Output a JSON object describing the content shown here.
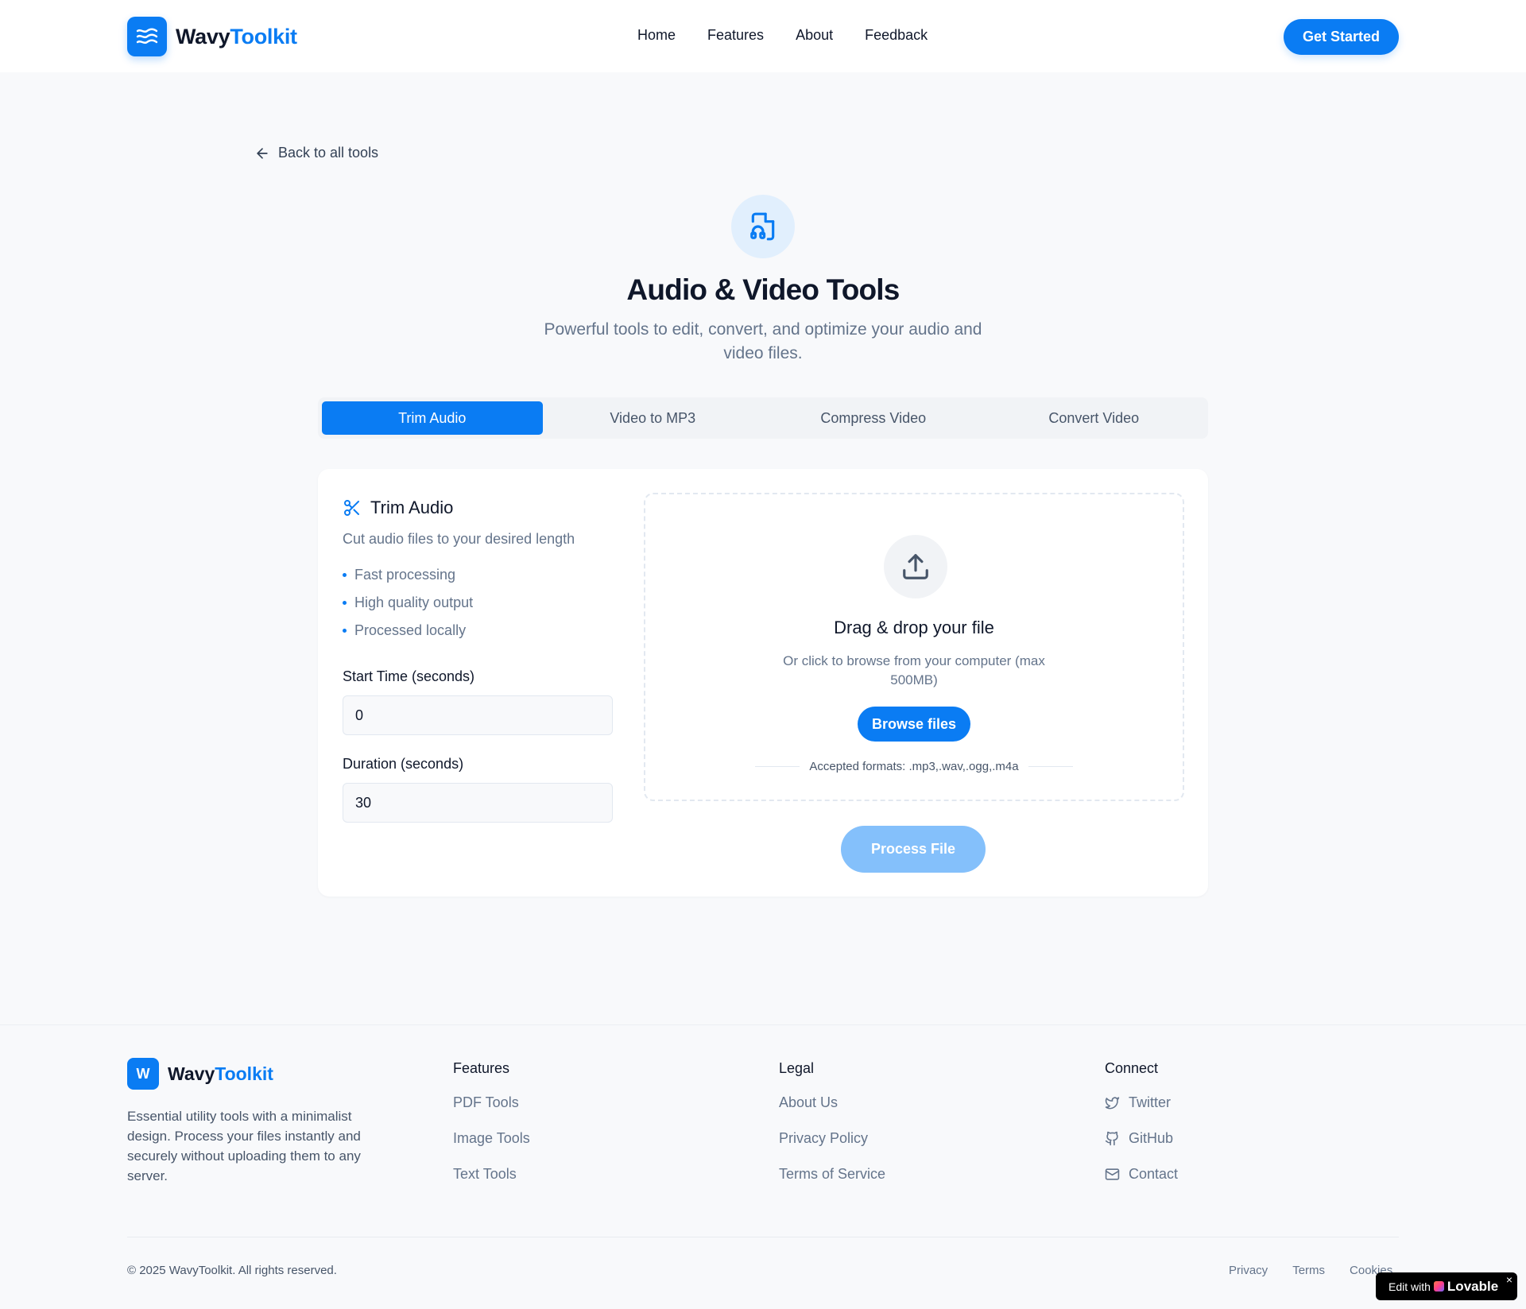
{
  "header": {
    "brand_part1": "Wavy",
    "brand_part2": "Toolkit",
    "nav": [
      "Home",
      "Features",
      "About",
      "Feedback"
    ],
    "cta": "Get Started"
  },
  "back_link": "Back to all tools",
  "hero": {
    "title": "Audio & Video Tools",
    "subtitle": "Powerful tools to edit, convert, and optimize your audio and video files."
  },
  "tabs": [
    {
      "label": "Trim Audio",
      "active": true
    },
    {
      "label": "Video to MP3",
      "active": false
    },
    {
      "label": "Compress Video",
      "active": false
    },
    {
      "label": "Convert Video",
      "active": false
    }
  ],
  "tool": {
    "title": "Trim Audio",
    "description": "Cut audio files to your desired length",
    "features": [
      "Fast processing",
      "High quality output",
      "Processed locally"
    ],
    "start_label": "Start Time (seconds)",
    "start_value": "0",
    "duration_label": "Duration (seconds)",
    "duration_value": "30"
  },
  "dropzone": {
    "title": "Drag & drop your file",
    "subtitle": "Or click to browse from your computer (max 500MB)",
    "browse": "Browse files",
    "formats": "Accepted formats: .mp3,.wav,.ogg,.m4a"
  },
  "process_button": "Process File",
  "footer": {
    "logo_letter": "W",
    "brand_part1": "Wavy",
    "brand_part2": "Toolkit",
    "description": "Essential utility tools with a minimalist design. Process your files instantly and securely without uploading them to any server.",
    "col_features": {
      "title": "Features",
      "links": [
        "PDF Tools",
        "Image Tools",
        "Text Tools"
      ]
    },
    "col_legal": {
      "title": "Legal",
      "links": [
        "About Us",
        "Privacy Policy",
        "Terms of Service"
      ]
    },
    "col_connect": {
      "title": "Connect",
      "links": [
        "Twitter",
        "GitHub",
        "Contact"
      ]
    },
    "copyright": "© 2025 WavyToolkit. All rights reserved.",
    "bottom_links": [
      "Privacy",
      "Terms",
      "Cookies"
    ]
  },
  "badge": {
    "prefix": "Edit with",
    "brand": "Lovable",
    "close": "×"
  },
  "colors": {
    "accent": "#0a7cf3",
    "accent_disabled": "#84c0fb",
    "text": "#0f172a",
    "muted": "#64748b"
  }
}
